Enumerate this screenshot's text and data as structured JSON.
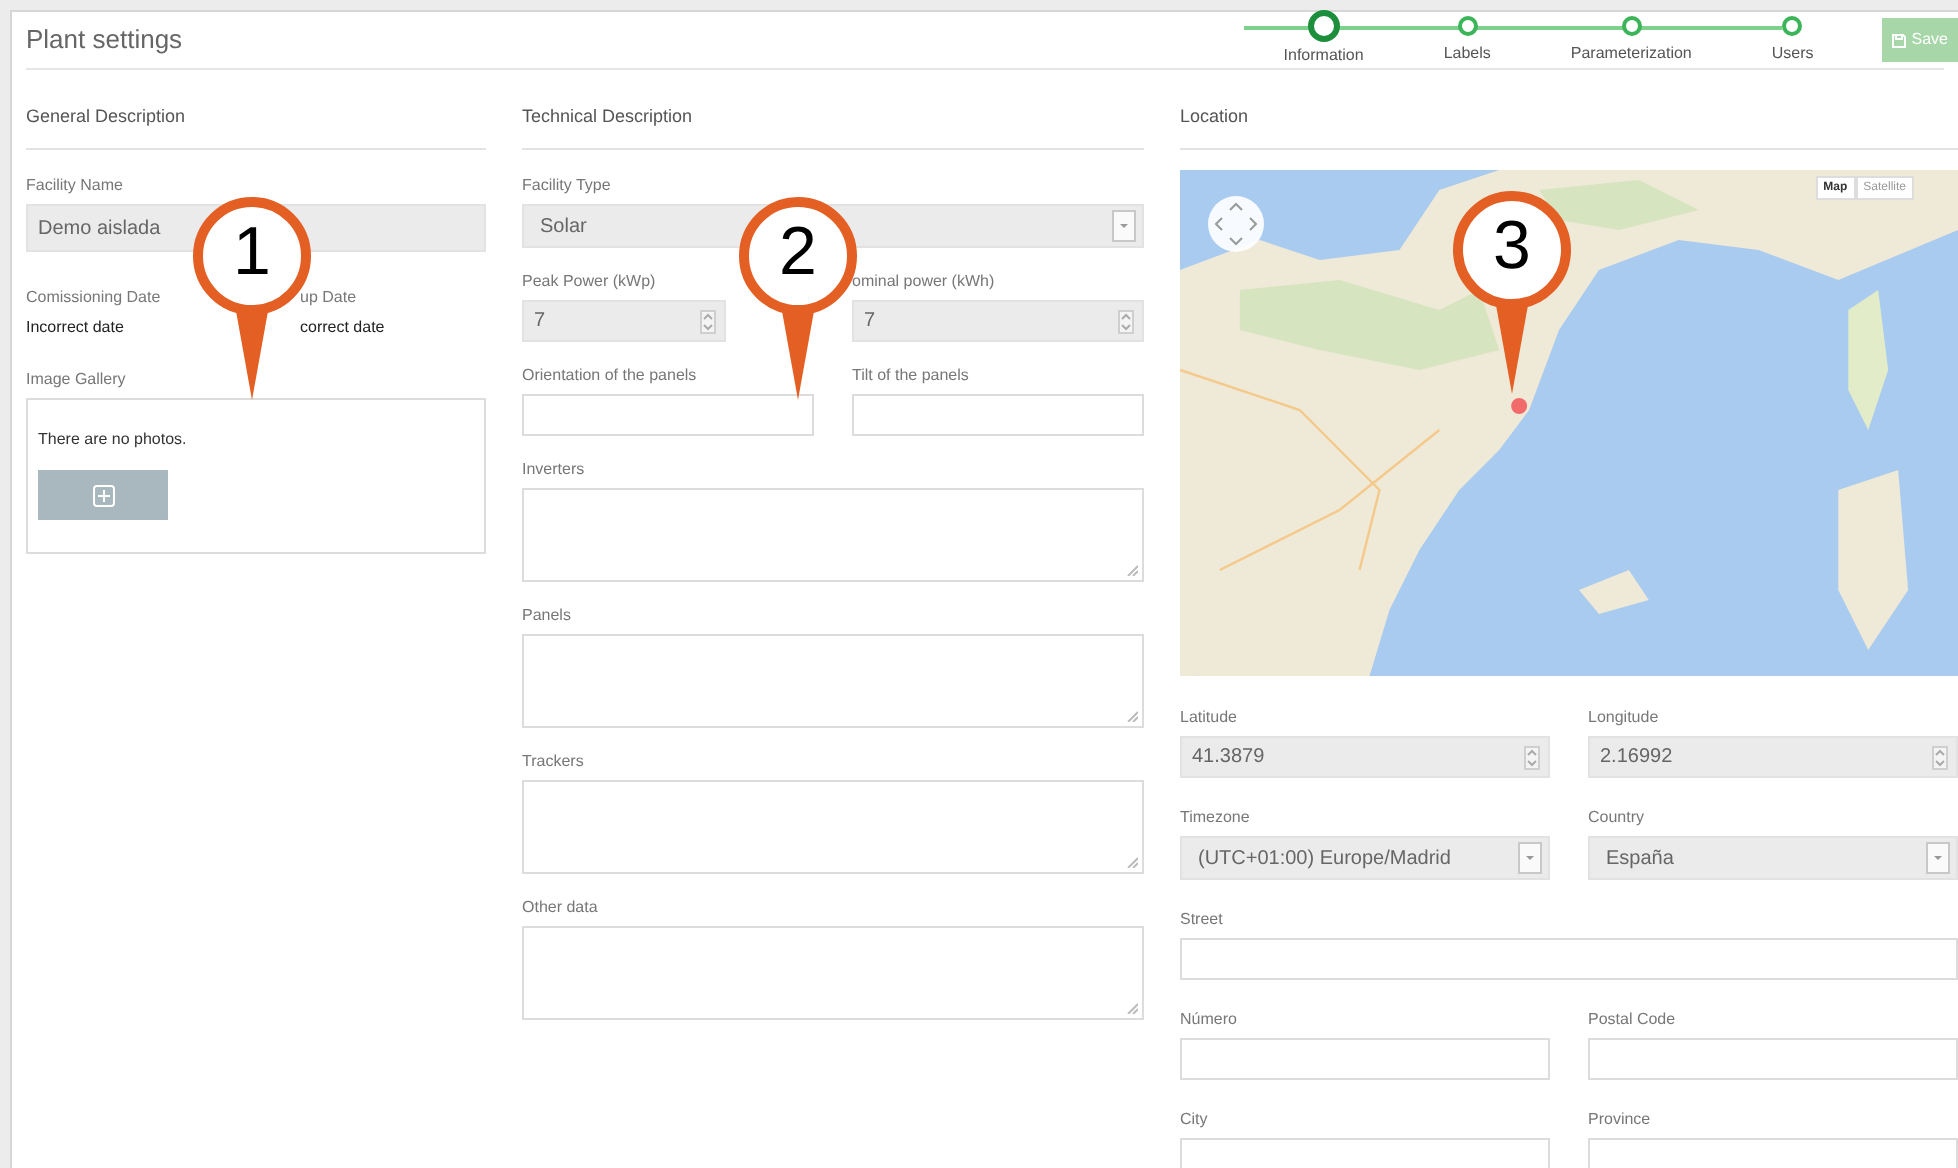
{
  "title": "Plant settings",
  "steps": [
    {
      "label": "Information",
      "selected": true
    },
    {
      "label": "Labels",
      "selected": false
    },
    {
      "label": "Parameterization",
      "selected": false
    },
    {
      "label": "Users",
      "selected": false
    }
  ],
  "save_button": {
    "label": "Save",
    "disabled": true
  },
  "general": {
    "heading": "General Description",
    "facility_name": {
      "label": "Facility Name",
      "value": "Demo aislada"
    },
    "dates": [
      {
        "label": "Comissioning Date",
        "value": "Incorrect date"
      },
      {
        "label": "up Date",
        "value": "correct date"
      }
    ],
    "gallery": {
      "label": "Image Gallery",
      "empty_text": "There are no photos."
    }
  },
  "technical": {
    "heading": "Technical Description",
    "rows": [
      [
        {
          "label": "Facility Type",
          "kind": "select",
          "value": "Solar",
          "readonly": true
        }
      ],
      [
        {
          "label": "Peak Power (kWp)",
          "kind": "number",
          "value": "7",
          "readonly": true
        },
        {
          "label": "ominal power (kWh)",
          "kind": "number",
          "value": "7",
          "readonly": true
        }
      ],
      [
        {
          "label": "Orientation of the panels",
          "kind": "text",
          "readonly": false
        },
        {
          "label": "Tilt of the panels",
          "kind": "text",
          "readonly": false
        }
      ],
      [
        {
          "label": "Inverters",
          "kind": "textarea",
          "readonly": false
        }
      ],
      [
        {
          "label": "Panels",
          "kind": "textarea",
          "readonly": false
        }
      ],
      [
        {
          "label": "Trackers",
          "kind": "textarea",
          "readonly": false
        }
      ],
      [
        {
          "label": "Other data",
          "kind": "textarea",
          "readonly": false
        }
      ]
    ]
  },
  "location": {
    "heading": "Location",
    "map": {
      "kind": "picture",
      "map_types": [
        {
          "label": "Map",
          "selected": true
        },
        {
          "label": "Satellite",
          "selected": false
        }
      ]
    },
    "rows": [
      [
        {
          "label": "Latitude",
          "kind": "number",
          "value": "41.3879",
          "readonly": true
        },
        {
          "label": "Longitude",
          "kind": "number",
          "value": "2.16992",
          "readonly": true
        }
      ],
      [
        {
          "label": "Timezone",
          "kind": "select",
          "value": "(UTC+01:00) Europe/Madrid",
          "readonly": true
        },
        {
          "label": "Country",
          "kind": "select",
          "value": "España",
          "readonly": true
        }
      ],
      [
        {
          "label": "Street",
          "kind": "text",
          "readonly": false
        }
      ],
      [
        {
          "label": "Número",
          "kind": "text",
          "readonly": false
        },
        {
          "label": "Postal Code",
          "kind": "text",
          "readonly": false
        }
      ],
      [
        {
          "label": "City",
          "kind": "text",
          "readonly": false
        },
        {
          "label": "Province",
          "kind": "text",
          "readonly": false
        }
      ]
    ]
  },
  "callouts": [
    "1",
    "2",
    "3"
  ]
}
